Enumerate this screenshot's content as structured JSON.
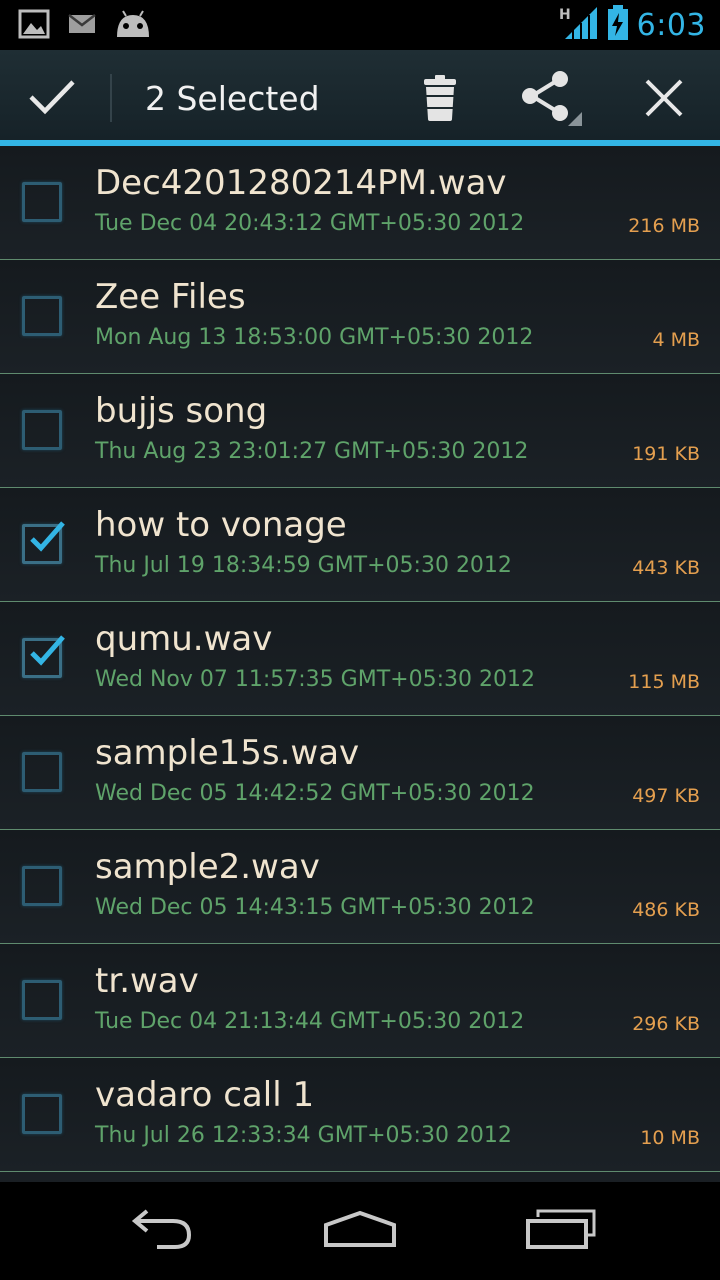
{
  "status_bar": {
    "time": "6:03",
    "network_label": "H",
    "icons": [
      "gallery-icon",
      "gmail-icon",
      "android-icon",
      "signal-icon",
      "battery-charging-icon"
    ]
  },
  "action_bar": {
    "title": "2 Selected",
    "icons": [
      "check-icon",
      "trash-icon",
      "share-icon",
      "close-icon"
    ]
  },
  "files": [
    {
      "name": "Dec4201280214PM.wav",
      "date": "Tue Dec 04 20:43:12 GMT+05:30 2012",
      "size": "216 MB",
      "checked": false
    },
    {
      "name": "Zee Files",
      "date": "Mon Aug 13 18:53:00 GMT+05:30 2012",
      "size": "4 MB",
      "checked": false
    },
    {
      "name": "bujjs song",
      "date": "Thu Aug 23 23:01:27 GMT+05:30 2012",
      "size": "191 KB",
      "checked": false
    },
    {
      "name": "how to vonage",
      "date": "Thu Jul 19 18:34:59 GMT+05:30 2012",
      "size": "443 KB",
      "checked": true
    },
    {
      "name": "qumu.wav",
      "date": "Wed Nov 07 11:57:35 GMT+05:30 2012",
      "size": "115 MB",
      "checked": true
    },
    {
      "name": "sample15s.wav",
      "date": "Wed Dec 05 14:42:52 GMT+05:30 2012",
      "size": "497 KB",
      "checked": false
    },
    {
      "name": "sample2.wav",
      "date": "Wed Dec 05 14:43:15 GMT+05:30 2012",
      "size": "486 KB",
      "checked": false
    },
    {
      "name": "tr.wav",
      "date": "Tue Dec 04 21:13:44 GMT+05:30 2012",
      "size": "296 KB",
      "checked": false
    },
    {
      "name": "vadaro call 1",
      "date": "Thu Jul 26 12:33:34 GMT+05:30 2012",
      "size": "10 MB",
      "checked": false
    }
  ],
  "nav_bar": {
    "icons": [
      "back-icon",
      "home-icon",
      "recent-apps-icon"
    ]
  },
  "colors": {
    "accent": "#33b5e5",
    "file_name": "#f0e4cf",
    "file_date": "#5fa36a",
    "file_size": "#e49f4f",
    "divider": "#5f8b6e"
  }
}
